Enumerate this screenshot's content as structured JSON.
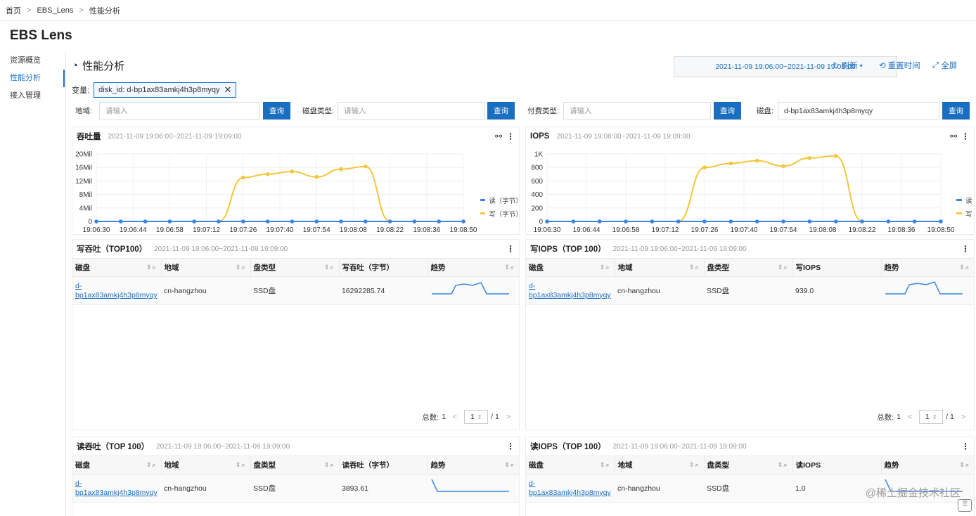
{
  "breadcrumb": [
    "首页",
    "EBS_Lens",
    "性能分析"
  ],
  "app_title": "EBS Lens",
  "sidebar": {
    "items": [
      "资源概览",
      "性能分析",
      "接入管理"
    ]
  },
  "page": {
    "title": "性能分析",
    "time_range": "2021-11-09 19:06:00~2021-11-09 19:09:00",
    "refresh": "刷新",
    "reset_time": "重置时间",
    "fullscreen": "全屏",
    "variable_label": "变量:",
    "variable_tag": "disk_id: d-bp1ax83amkj4h3p8myqy"
  },
  "filters": [
    {
      "label": "地域:",
      "placeholder": "请输入",
      "value": "",
      "button": "查询"
    },
    {
      "label": "磁盘类型:",
      "placeholder": "请输入",
      "value": "",
      "button": "查询"
    },
    {
      "label": "付费类型:",
      "placeholder": "请输入",
      "value": "",
      "button": "查询"
    },
    {
      "label": "磁盘:",
      "placeholder": "",
      "value": "d-bp1ax83amkj4h3p8myqy",
      "button": "查询"
    }
  ],
  "chart_data": [
    {
      "type": "line",
      "title": "吞吐量",
      "subtitle": "2021-11-09 19:06:00~2021-11-09 19:09:00",
      "x": [
        "19:06:30",
        "19:06:44",
        "19:06:58",
        "19:07:12",
        "19:07:26",
        "19:07:40",
        "19:07:54",
        "19:08:08",
        "19:08:22",
        "19:08:36",
        "19:08:50"
      ],
      "y_ticks": [
        "0",
        "4Mil",
        "8Mil",
        "12Mil",
        "16Mil",
        "20Mil"
      ],
      "ylim": [
        0,
        20000000
      ],
      "series": [
        {
          "name": "读（字节）",
          "color": "#3b86e0",
          "values": [
            0,
            0,
            0,
            0,
            0,
            0,
            0,
            0,
            0,
            0,
            0,
            0,
            0,
            0,
            0,
            0
          ]
        },
        {
          "name": "写（字节）",
          "color": "#f3c63b",
          "values": [
            0,
            0,
            0,
            0,
            0,
            0,
            13000000,
            14000000,
            14800000,
            13200000,
            15500000,
            16300000,
            0,
            0,
            0,
            0
          ]
        }
      ],
      "legend": "right"
    },
    {
      "type": "line",
      "title": "IOPS",
      "subtitle": "2021-11-09 19:06:00~2021-11-09 19:09:00",
      "x": [
        "19:06:30",
        "19:06:44",
        "19:06:58",
        "19:07:12",
        "19:07:26",
        "19:07:40",
        "19:07:54",
        "19:08:08",
        "19:08:22",
        "19:08:36",
        "19:08:50"
      ],
      "y_ticks": [
        "0",
        "200",
        "400",
        "600",
        "800",
        "1K"
      ],
      "ylim": [
        0,
        1000
      ],
      "series": [
        {
          "name": "读",
          "color": "#3b86e0",
          "values": [
            0,
            0,
            0,
            0,
            0,
            0,
            0,
            0,
            0,
            0,
            0,
            0,
            0,
            0,
            0,
            0
          ]
        },
        {
          "name": "写",
          "color": "#f3c63b",
          "values": [
            0,
            0,
            0,
            0,
            0,
            0,
            800,
            860,
            900,
            820,
            940,
            970,
            0,
            0,
            0,
            0
          ]
        }
      ],
      "legend": "right"
    }
  ],
  "tables": [
    {
      "title": "写吞吐（TOP100）",
      "subtitle": "2021-11-09 19:06:00~2021-11-09 19:09:00",
      "columns": [
        "磁盘",
        "地域",
        "盘类型",
        "写吞吐（字节）",
        "趋势"
      ],
      "rows": [
        {
          "disk": "d-bp1ax83amkj4h3p8myqy",
          "region": "cn-hangzhou",
          "type": "SSD盘",
          "value": "16292285.74"
        }
      ],
      "total_label": "总数:",
      "total": "1",
      "page": "1",
      "pages": "/ 1"
    },
    {
      "title": "写IOPS（TOP 100）",
      "subtitle": "2021-11-09 19:06:00~2021-11-09 19:09:00",
      "columns": [
        "磁盘",
        "地域",
        "盘类型",
        "写IOPS",
        "趋势"
      ],
      "rows": [
        {
          "disk": "d-bp1ax83amkj4h3p8myqy",
          "region": "cn-hangzhou",
          "type": "SSD盘",
          "value": "939.0"
        }
      ],
      "total_label": "总数:",
      "total": "1",
      "page": "1",
      "pages": "/ 1"
    },
    {
      "title": "读吞吐（TOP 100）",
      "subtitle": "2021-11-09 19:06:00~2021-11-09 19:09:00",
      "columns": [
        "磁盘",
        "地域",
        "盘类型",
        "读吞吐（字节）",
        "趋势"
      ],
      "rows": [
        {
          "disk": "d-bp1ax83amkj4h3p8myqy",
          "region": "cn-hangzhou",
          "type": "SSD盘",
          "value": "3893.61"
        }
      ]
    },
    {
      "title": "读IOPS（TOP 100）",
      "subtitle": "2021-11-09 19:06:00~2021-11-09 19:09:00",
      "columns": [
        "磁盘",
        "地域",
        "盘类型",
        "读IOPS",
        "趋势"
      ],
      "rows": [
        {
          "disk": "d-bp1ax83amkj4h3p8myqy",
          "region": "cn-hangzhou",
          "type": "SSD盘",
          "value": "1.0"
        }
      ]
    }
  ],
  "watermark": "@稀土掘金技术社区",
  "colors": {
    "accent": "#1a6ec0",
    "read": "#3b86e0",
    "write": "#f3c63b"
  }
}
